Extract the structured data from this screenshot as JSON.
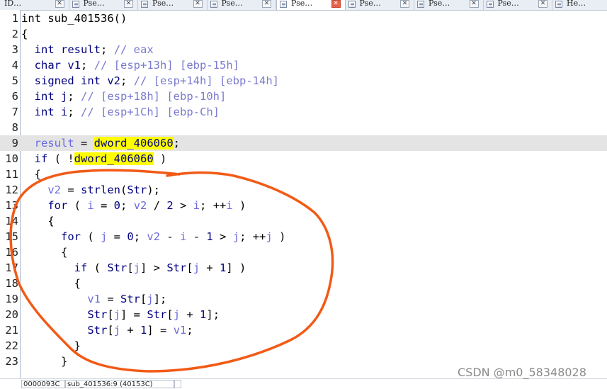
{
  "tabs": [
    {
      "label": "ID…",
      "active": false
    },
    {
      "label": "Pse…",
      "active": false
    },
    {
      "label": "Pse…",
      "active": false
    },
    {
      "label": "Pse…",
      "active": false
    },
    {
      "label": "Pse…",
      "active": true
    },
    {
      "label": "Pse…",
      "active": false
    },
    {
      "label": "Pse…",
      "active": false
    },
    {
      "label": "Pse…",
      "active": false
    },
    {
      "label": "He…",
      "active": false
    }
  ],
  "code_lines": [
    {
      "n": "1",
      "html": "int sub_401536()"
    },
    {
      "n": "2",
      "html": "{"
    },
    {
      "n": "3",
      "html": "  <span class='kw'>int</span> <span class='vr'>result</span>; <span class='cm'>// eax</span>"
    },
    {
      "n": "4",
      "html": "  <span class='kw'>char</span> <span class='vr'>v1</span>; <span class='cm'>// [esp+13h] [ebp-15h]</span>"
    },
    {
      "n": "5",
      "html": "  <span class='kw'>signed int</span> <span class='vr'>v2</span>; <span class='cm'>// [esp+14h] [ebp-14h]</span>"
    },
    {
      "n": "6",
      "html": "  <span class='kw'>int</span> <span class='vr'>j</span>; <span class='cm'>// [esp+18h] [ebp-10h]</span>"
    },
    {
      "n": "7",
      "html": "  <span class='kw'>int</span> <span class='vr'>i</span>; <span class='cm'>// [esp+1Ch] [ebp-Ch]</span>"
    },
    {
      "n": "8",
      "html": ""
    },
    {
      "n": "9",
      "html": "  <span class='lv'>result</span> = <span class='yel'>dword_406060</span>;"
    },
    {
      "n": "10",
      "html": "  <span class='kw'>if</span> ( !<span class='yel'>dword_406060</span> )"
    },
    {
      "n": "11",
      "html": "  {"
    },
    {
      "n": "12",
      "html": "    <span class='lv'>v2</span> = <span class='sym'>strlen</span>(<span class='sym'>Str</span>);"
    },
    {
      "n": "13",
      "html": "    <span class='kw'>for</span> ( <span class='lv'>i</span> = <span class='num'>0</span>; <span class='lv'>v2</span> / <span class='num'>2</span> &gt; <span class='lv'>i</span>; ++<span class='lv'>i</span> )"
    },
    {
      "n": "14",
      "html": "    {"
    },
    {
      "n": "15",
      "html": "      <span class='kw'>for</span> ( <span class='lv'>j</span> = <span class='num'>0</span>; <span class='lv'>v2</span> - <span class='lv'>i</span> - <span class='num'>1</span> &gt; <span class='lv'>j</span>; ++<span class='lv'>j</span> )"
    },
    {
      "n": "16",
      "html": "      {"
    },
    {
      "n": "17",
      "html": "        <span class='kw'>if</span> ( <span class='sym'>Str</span>[<span class='lv'>j</span>] &gt; <span class='sym'>Str</span>[<span class='lv'>j</span> + <span class='num'>1</span>] )"
    },
    {
      "n": "18",
      "html": "        {"
    },
    {
      "n": "19",
      "html": "          <span class='lv'>v1</span> = <span class='sym'>Str</span>[<span class='lv'>j</span>];"
    },
    {
      "n": "20",
      "html": "          <span class='sym'>Str</span>[<span class='lv'>j</span>] = <span class='sym'>Str</span>[<span class='lv'>j</span> + <span class='num'>1</span>];"
    },
    {
      "n": "21",
      "html": "          <span class='sym'>Str</span>[<span class='lv'>j</span> + <span class='num'>1</span>] = <span class='lv'>v1</span>;"
    },
    {
      "n": "22",
      "html": "        }"
    },
    {
      "n": "23",
      "html": "      }"
    }
  ],
  "status": {
    "address": "0000093C",
    "location": "sub_401536:9 (40153C)"
  },
  "watermark": "CSDN @m0_58348028",
  "colors": {
    "keyword": "#000080",
    "local_var": "#6a6adf",
    "comment": "#7a7ad0",
    "highlight": "#ffff00",
    "current_line": "#e4e4e4",
    "annotation_stroke": "#f25a16"
  }
}
